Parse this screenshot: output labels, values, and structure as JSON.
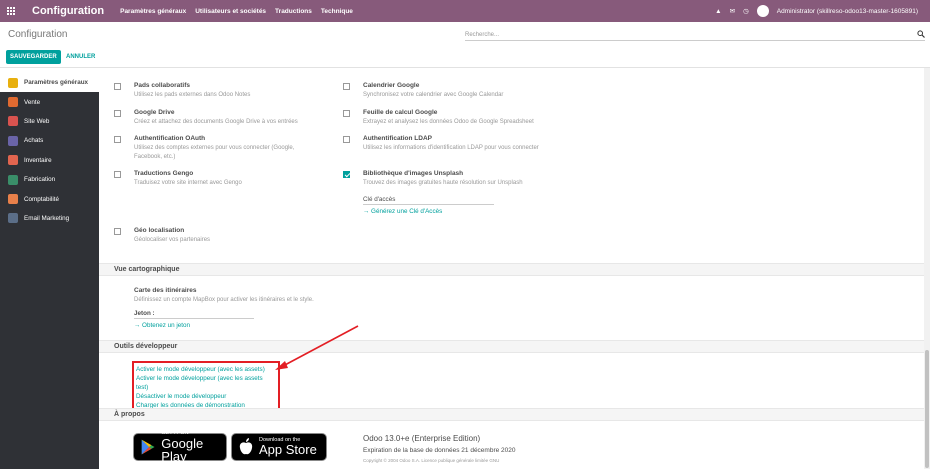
{
  "topbar": {
    "app_title": "Configuration",
    "menu": [
      "Paramètres généraux",
      "Utilisateurs et sociétés",
      "Traductions",
      "Technique"
    ],
    "user": "Administrator (skillreso-odoo13-master-1605891)",
    "color": "#875a7b"
  },
  "control_panel": {
    "breadcrumb": "Configuration",
    "search_placeholder": "Recherche...",
    "save_label": "SAUVEGARDER",
    "cancel_label": "ANNULER"
  },
  "sidebar": {
    "items": [
      {
        "label": "Paramètres généraux",
        "icon": "settings-app-icon",
        "color": "#e8b00f"
      },
      {
        "label": "Vente",
        "icon": "sales-app-icon",
        "color": "#e06a31"
      },
      {
        "label": "Site Web",
        "icon": "website-app-icon",
        "color": "#d9534f"
      },
      {
        "label": "Achats",
        "icon": "purchase-app-icon",
        "color": "#6a64a8"
      },
      {
        "label": "Inventaire",
        "icon": "inventory-app-icon",
        "color": "#e2654f"
      },
      {
        "label": "Fabrication",
        "icon": "manufacturing-app-icon",
        "color": "#3a8e69"
      },
      {
        "label": "Comptabilité",
        "icon": "accounting-app-icon",
        "color": "#e8804a"
      },
      {
        "label": "Email Marketing",
        "icon": "email-marketing-app-icon",
        "color": "#5b6e88"
      }
    ]
  },
  "integrations": {
    "left": [
      {
        "title": "Pads collaboratifs",
        "desc": "Utilisez les pads externes dans Odoo Notes",
        "checked": false
      },
      {
        "title": "Google Drive",
        "desc": "Créez et attachez des documents Google Drive à vos entrées",
        "checked": false
      },
      {
        "title": "Authentification OAuth",
        "desc": "Utilisez des comptes externes pour vous connecter (Google, Facebook, etc.)",
        "checked": false
      },
      {
        "title": "Traductions Gengo",
        "desc": "Traduisez votre site internet avec Gengo",
        "checked": false
      },
      {
        "title": "Géo localisation",
        "desc": "Géolocaliser vos partenaires",
        "checked": false
      }
    ],
    "right": [
      {
        "title": "Calendrier Google",
        "desc": "Synchronisez votre calendrier avec Google Calendar",
        "checked": false
      },
      {
        "title": "Feuille de calcul Google",
        "desc": "Extrayez et analysez les données Odoo de Google Spreadsheet",
        "checked": false
      },
      {
        "title": "Authentification LDAP",
        "desc": "Utilisez les informations d'identification LDAP pour vous connecter",
        "checked": false
      },
      {
        "title": "Bibliothèque d'images Unsplash",
        "desc": "Trouvez des images gratuites haute résolution sur Unsplash",
        "checked": true
      }
    ],
    "unsplash_key_label": "Clé d'accès",
    "unsplash_key_link": "Générez une Clé d'Accès"
  },
  "map_view": {
    "section_title": "Vue cartographique",
    "title": "Carte des itinéraires",
    "desc": "Définissez un compte MapBox pour activer les itinéraires et le style.",
    "token_label": "Jeton :",
    "token_link": "Obtenez un jeton"
  },
  "dev_tools": {
    "section_title": "Outils développeur",
    "links": [
      "Activer le mode développeur (avec les assets)",
      "Activer le mode développeur (avec les assets test)",
      "Désactiver le mode développeur",
      "Charger les données de démonstration"
    ],
    "highlight_color": "#e31e24"
  },
  "about": {
    "section_title": "À propos",
    "google_play_small": "GET IT ON",
    "google_play_big": "Google Play",
    "app_store_small": "Download on the",
    "app_store_big": "App Store",
    "version": "Odoo 13.0+e (Enterprise Edition)",
    "expiration": "Expiration de la base de données 21 décembre 2020",
    "copyright": "Copyright © 2004 Odoo S.A. Licence publique générale limitée GNU"
  },
  "accent": "#00a09d"
}
